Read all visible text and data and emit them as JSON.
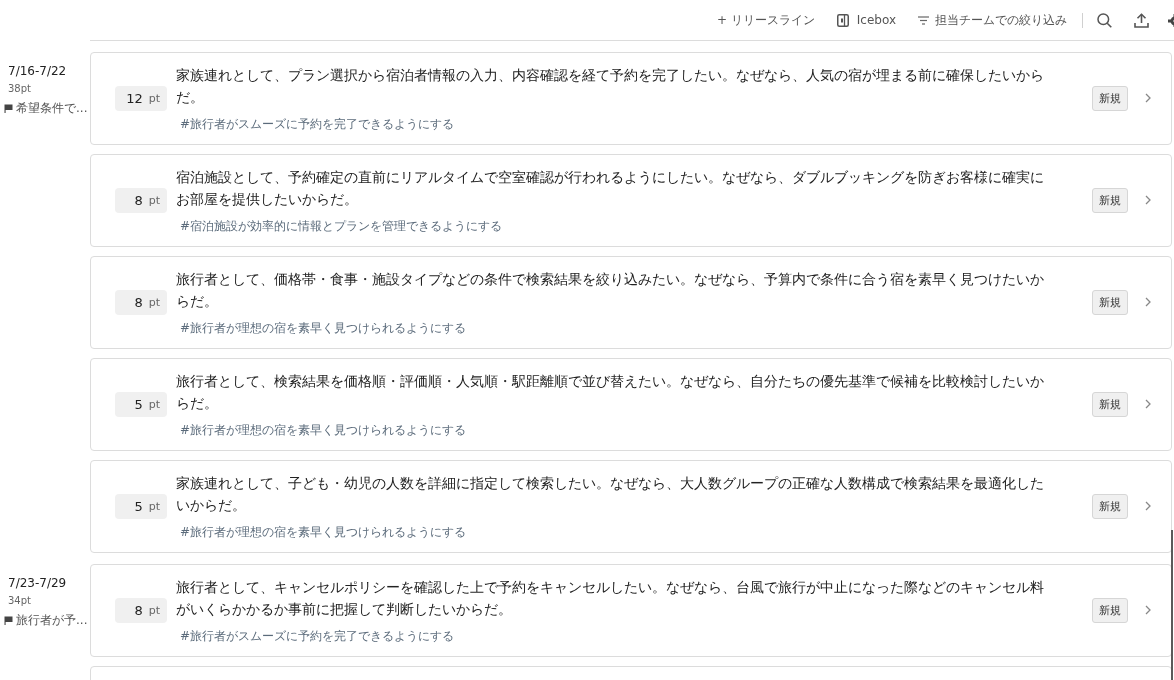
{
  "toolbar": {
    "actions": [
      {
        "kind": "add",
        "label": "+ リリースライン"
      },
      {
        "kind": "icebox",
        "label": "Icebox"
      },
      {
        "kind": "filter",
        "label": "担当チームでの絞り込み"
      }
    ]
  },
  "sprints": [
    {
      "dates": "7/16-7/22",
      "points": "38pt",
      "goal": "希望条件で...",
      "more_below": false,
      "stories": [
        {
          "points": "12",
          "unit": "pt",
          "text": "家族連れとして、プラン選択から宿泊者情報の入力、内容確認を経て予約を完了したい。なぜなら、人気の宿が埋まる前に確保したいからだ。",
          "tag": "#旅行者がスムーズに予約を完了できるようにする",
          "status": "新規"
        },
        {
          "points": "8",
          "unit": "pt",
          "text": "宿泊施設として、予約確定の直前にリアルタイムで空室確認が行われるようにしたい。なぜなら、ダブルブッキングを防ぎお客様に確実にお部屋を提供したいからだ。",
          "tag": "#宿泊施設が効率的に情報とプランを管理できるようにする",
          "status": "新規"
        },
        {
          "points": "8",
          "unit": "pt",
          "text": "旅行者として、価格帯・食事・施設タイプなどの条件で検索結果を絞り込みたい。なぜなら、予算内で条件に合う宿を素早く見つけたいからだ。",
          "tag": "#旅行者が理想の宿を素早く見つけられるようにする",
          "status": "新規"
        },
        {
          "points": "5",
          "unit": "pt",
          "text": "旅行者として、検索結果を価格順・評価順・人気順・駅距離順で並び替えたい。なぜなら、自分たちの優先基準で候補を比較検討したいからだ。",
          "tag": "#旅行者が理想の宿を素早く見つけられるようにする",
          "status": "新規"
        },
        {
          "points": "5",
          "unit": "pt",
          "text": "家族連れとして、子ども・幼児の人数を詳細に指定して検索したい。なぜなら、大人数グループの正確な人数構成で検索結果を最適化したいからだ。",
          "tag": "#旅行者が理想の宿を素早く見つけられるようにする",
          "status": "新規"
        }
      ]
    },
    {
      "dates": "7/23-7/29",
      "points": "34pt",
      "goal": "旅行者が予...",
      "more_below": true,
      "stories": [
        {
          "points": "8",
          "unit": "pt",
          "text": "旅行者として、キャンセルポリシーを確認した上で予約をキャンセルしたい。なぜなら、台風で旅行が中止になった際などのキャンセル料がいくらかかるか事前に把握して判断したいからだ。",
          "tag": "#旅行者がスムーズに予約を完了できるようにする",
          "status": "新規"
        }
      ]
    }
  ]
}
